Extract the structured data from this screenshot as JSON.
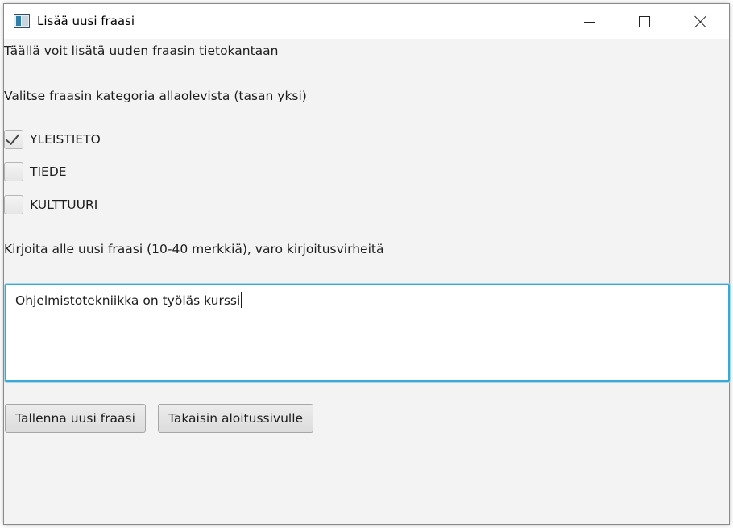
{
  "window": {
    "title": "Lisää uusi fraasi",
    "controls": [
      "minimize-icon",
      "maximize-icon",
      "close-icon"
    ]
  },
  "form": {
    "intro": "Täällä voit lisätä uuden fraasin tietokantaan",
    "category_prompt": "Valitse fraasin kategoria allaolevista (tasan yksi)",
    "categories": [
      {
        "label": "YLEISTIETO",
        "checked": true
      },
      {
        "label": "TIEDE",
        "checked": false
      },
      {
        "label": "KULTTUURI",
        "checked": false
      }
    ],
    "phrase_prompt": "Kirjoita alle uusi fraasi (10-40 merkkiä), varo kirjoitusvirheitä",
    "phrase_value": "Ohjelmistotekniikka on työläs kurssi"
  },
  "buttons": {
    "save_label": "Tallenna uusi fraasi",
    "back_label": "Takaisin aloitussivulle"
  },
  "colors": {
    "focus_border": "#3ba9d6",
    "window_bg": "#f3f3f3"
  }
}
